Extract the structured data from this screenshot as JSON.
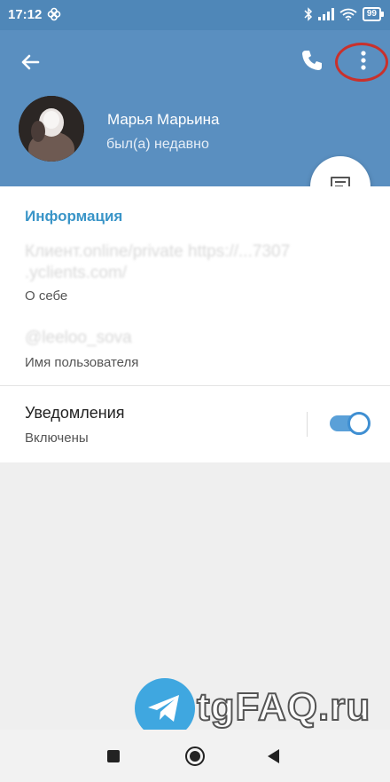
{
  "status_bar": {
    "time": "17:12",
    "battery": "99"
  },
  "profile": {
    "name": "Марья Марьина",
    "last_seen": "был(а) недавно"
  },
  "info": {
    "section_title": "Информация",
    "bio_value": "Клиент.online/private https://...7307 .yclients.com/",
    "bio_label": "О себе",
    "username_value": "@leeloo_sova",
    "username_label": "Имя пользователя"
  },
  "notifications": {
    "title": "Уведомления",
    "status": "Включены",
    "enabled": true
  },
  "watermark": {
    "text": "tgFAQ.ru"
  },
  "colors": {
    "header": "#5a8fc0",
    "status_bar": "#4f87b8",
    "accent": "#3a95c8",
    "toggle": "#3f8fd2",
    "highlight_circle": "#c9312c"
  },
  "icons": [
    "back-arrow-icon",
    "phone-icon",
    "more-vertical-icon",
    "message-icon",
    "wifi-icon",
    "bluetooth-icon",
    "signal-icon",
    "battery-icon"
  ]
}
